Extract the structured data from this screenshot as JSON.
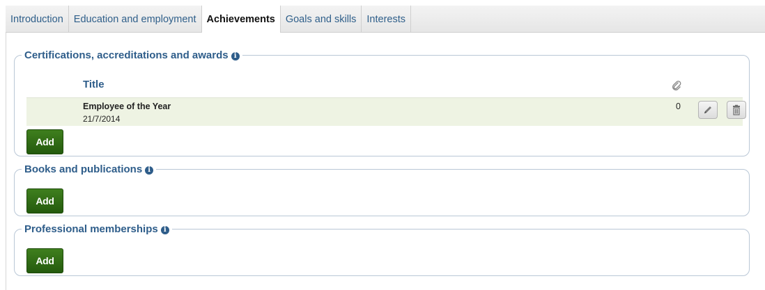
{
  "tabs": [
    {
      "label": "Introduction",
      "active": false
    },
    {
      "label": "Education and employment",
      "active": false
    },
    {
      "label": "Achievements",
      "active": true
    },
    {
      "label": "Goals and skills",
      "active": false
    },
    {
      "label": "Interests",
      "active": false
    }
  ],
  "sections": {
    "certifications": {
      "title": "Certifications, accreditations and awards",
      "column_title": "Title",
      "attachments_icon": "paperclip-icon",
      "rows": [
        {
          "title": "Employee of the Year",
          "date": "21/7/2014",
          "attachments": "0"
        }
      ],
      "add_label": "Add"
    },
    "books": {
      "title": "Books and publications",
      "add_label": "Add"
    },
    "memberships": {
      "title": "Professional memberships",
      "add_label": "Add"
    }
  },
  "colors": {
    "accent": "#2e5d8a",
    "add_button": "#2f6b14",
    "row_highlight": "#eef3e3"
  }
}
